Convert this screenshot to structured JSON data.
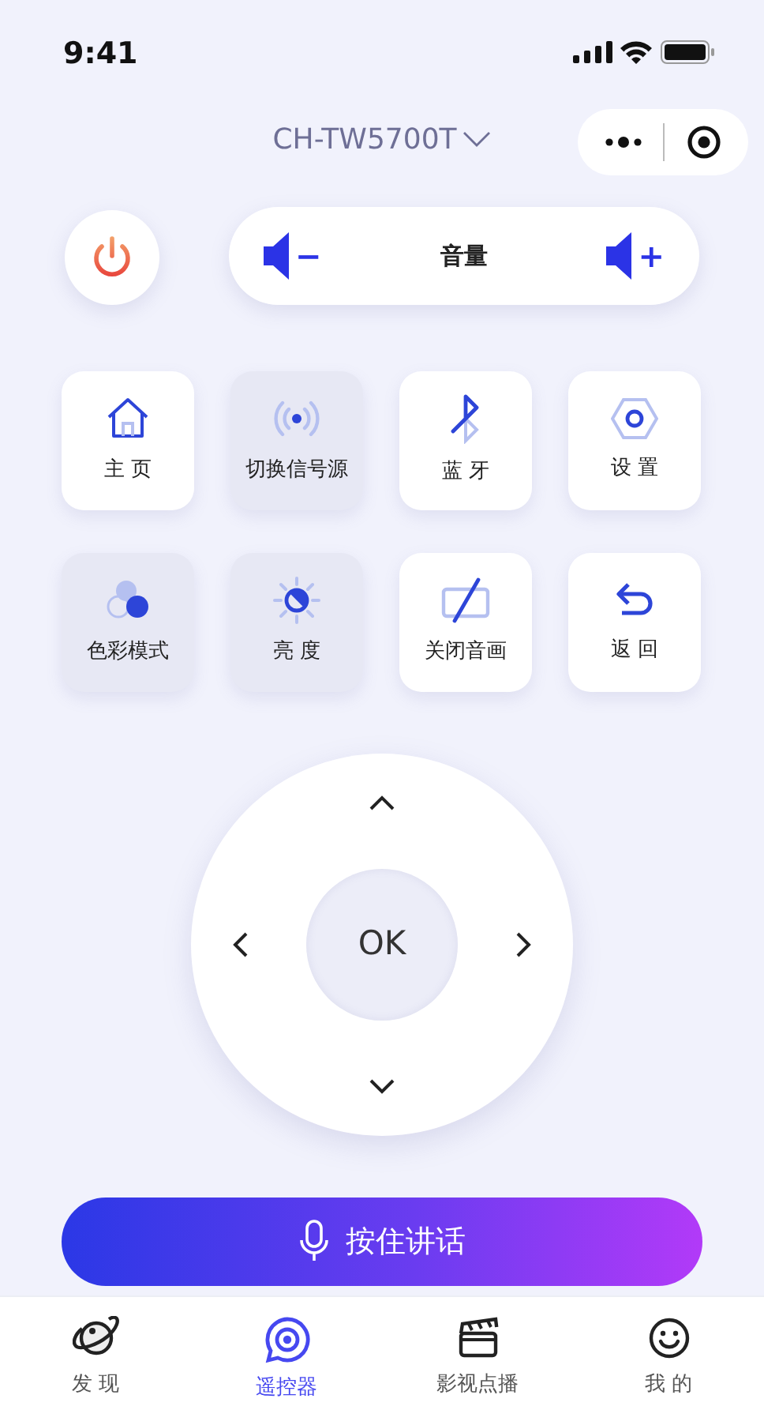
{
  "status_bar": {
    "time": "9:41"
  },
  "header": {
    "device": "CH-TW5700T"
  },
  "volume": {
    "label": "音量",
    "minus": "−",
    "plus": "+"
  },
  "tiles": [
    {
      "kind": "home",
      "label": "主 页",
      "highlighted": false
    },
    {
      "kind": "source",
      "label": "切换信号源",
      "highlighted": true
    },
    {
      "kind": "bluetooth",
      "label": "蓝 牙",
      "highlighted": false
    },
    {
      "kind": "settings",
      "label": "设 置",
      "highlighted": false
    },
    {
      "kind": "color",
      "label": "色彩模式",
      "highlighted": true
    },
    {
      "kind": "brightness",
      "label": "亮 度",
      "highlighted": true
    },
    {
      "kind": "screen-off",
      "label": "关闭音画",
      "highlighted": false
    },
    {
      "kind": "back",
      "label": "返 回",
      "highlighted": false
    }
  ],
  "dpad": {
    "ok": "OK"
  },
  "voice_button": {
    "label": "按住讲话"
  },
  "tab_bar": [
    {
      "kind": "planet",
      "label": "发 现",
      "selected": false
    },
    {
      "kind": "remote",
      "label": "遥控器",
      "selected": true
    },
    {
      "kind": "clapper",
      "label": "影视点播",
      "selected": false
    },
    {
      "kind": "smile",
      "label": "我 的",
      "selected": false
    }
  ]
}
